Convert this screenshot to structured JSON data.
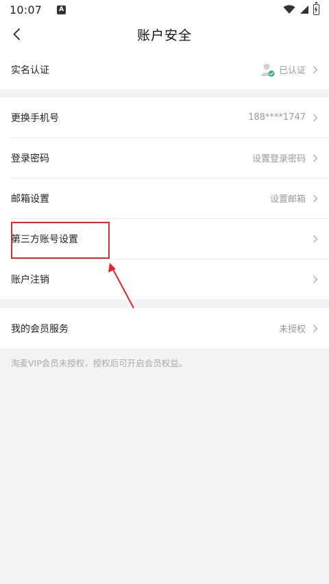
{
  "status_bar": {
    "time": "10:07",
    "notification_letter": "A",
    "icons": [
      "a-app-icon",
      "wifi-icon",
      "signal-icon",
      "battery-charging-icon"
    ]
  },
  "navbar": {
    "back_icon": "chevron-left-icon",
    "title": "账户安全"
  },
  "groups": [
    {
      "rows": [
        {
          "label": "实名认证",
          "value": "已认证",
          "icon": "verified-user-icon"
        }
      ]
    },
    {
      "rows": [
        {
          "label": "更换手机号",
          "value": "188****1747"
        },
        {
          "label": "登录密码",
          "value": "设置登录密码"
        },
        {
          "label": "邮箱设置",
          "value": "设置邮箱"
        },
        {
          "label": "第三方账号设置",
          "value": ""
        },
        {
          "label": "账户注销",
          "value": ""
        }
      ]
    },
    {
      "rows": [
        {
          "label": "我的会员服务",
          "value": "未授权"
        }
      ]
    }
  ],
  "footnote": "淘麦VIP会员未授权，授权后可开启会员权益。",
  "annotation": {
    "color": "#e5252c",
    "shapes": [
      "highlight-box",
      "arrow-pointer"
    ]
  },
  "colors": {
    "background": "#f2f3f5",
    "card": "#ffffff",
    "muted_text": "#999999",
    "verified_green": "#2bb673"
  }
}
